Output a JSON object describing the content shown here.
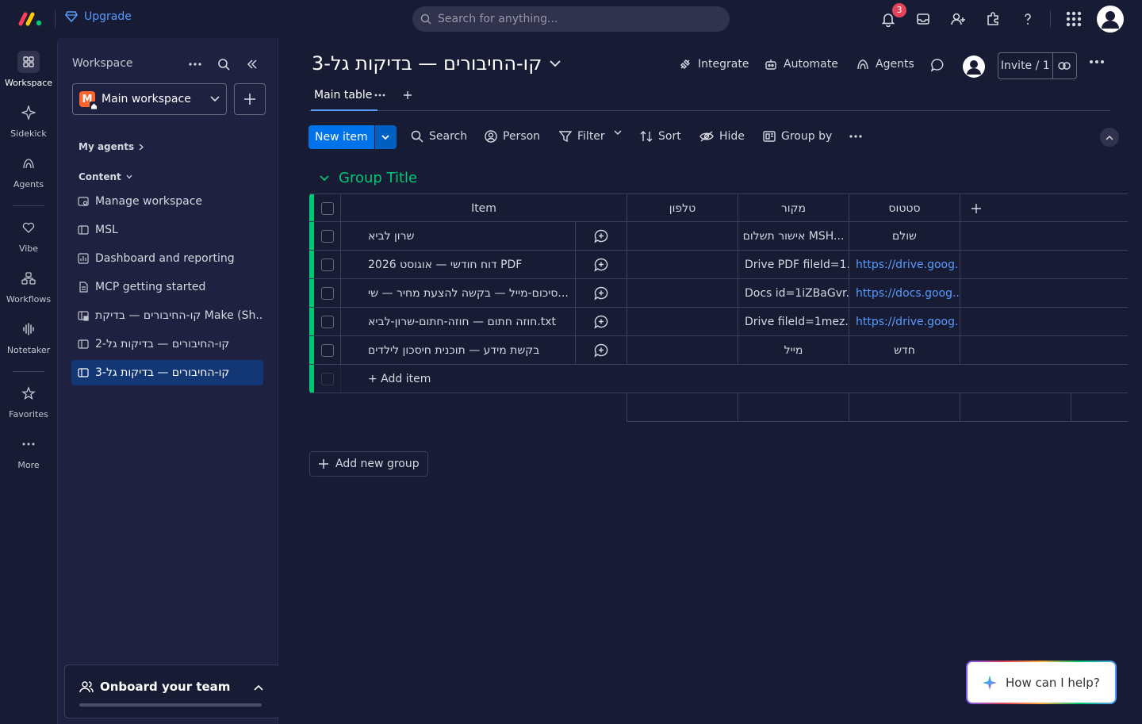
{
  "topbar": {
    "upgrade_label": "Upgrade",
    "search_placeholder": "Search for anything...",
    "notification_count": "3",
    "colors": {
      "accent": "#579bfc",
      "badge": "#e2445c"
    }
  },
  "rail": {
    "items": [
      {
        "label": "Workspace",
        "icon": "grid-icon"
      },
      {
        "label": "Sidekick",
        "icon": "sparkle-icon"
      },
      {
        "label": "Agents",
        "icon": "agents-icon"
      },
      {
        "label": "Vibe",
        "icon": "heart-icon"
      },
      {
        "label": "Workflows",
        "icon": "workflows-icon"
      },
      {
        "label": "Notetaker",
        "icon": "waveform-icon"
      },
      {
        "label": "Favorites",
        "icon": "star-icon"
      },
      {
        "label": "More",
        "icon": "more-icon"
      }
    ]
  },
  "workspace_panel": {
    "title": "Workspace",
    "selected_workspace": "Main workspace",
    "workspace_initial": "M",
    "my_agents_label": "My agents",
    "content_label": "Content",
    "items": [
      {
        "label": "Manage workspace"
      },
      {
        "label": "MSL"
      },
      {
        "label": "Dashboard and reporting"
      },
      {
        "label": "MCP getting started"
      },
      {
        "label": "קו-החיבורים — בדיקת Make (Sh..."
      },
      {
        "label": "קו-החיבורים — בדיקות גל-2"
      },
      {
        "label": "קו-החיבורים — בדיקות גל-3"
      }
    ],
    "onboard_label": "Onboard your team"
  },
  "board": {
    "title": "קו-החיבורים — בדיקות גל-3",
    "integrate_label": "Integrate",
    "automate_label": "Automate",
    "agents_label": "Agents",
    "invite_label": "Invite / 1",
    "tabs": [
      {
        "label": "Main table"
      }
    ],
    "toolbar": {
      "new_item": "New item",
      "search": "Search",
      "person": "Person",
      "filter": "Filter",
      "sort": "Sort",
      "hide": "Hide",
      "group_by": "Group by"
    },
    "group_title": "Group Title",
    "group_color": "#00c875",
    "columns": {
      "item": "Item",
      "phone": "טלפון",
      "source": "מקור",
      "status": "סטטוס"
    },
    "rows": [
      {
        "item": "שרון לביא",
        "phone": "",
        "source": "אישור תשלום MSH...",
        "status": "שולם",
        "status_is_link": false
      },
      {
        "item": "דוח חודשי — אוגוסט 2026 PDF",
        "phone": "",
        "source": "Drive PDF fileId=1...",
        "status": "https://drive.goog...",
        "status_is_link": true
      },
      {
        "item": "סיכום-מייל — בקשה להצעת מחיר — שי...",
        "phone": "",
        "source": "Docs id=1iZBaGvr...",
        "status": "https://docs.goog...",
        "status_is_link": true
      },
      {
        "item": "חוזה חתום — חוזה-חתום-שרון-לביא.txt",
        "phone": "",
        "source": "Drive fileId=1mez...",
        "status": "https://drive.goog...",
        "status_is_link": true
      },
      {
        "item": "בקשת מידע — תוכנית חיסכון לילדים",
        "phone": "",
        "source": "מייל",
        "status": "חדש",
        "status_is_link": false
      }
    ],
    "add_item_label": "+ Add item",
    "add_group_label": "Add new group"
  },
  "help_widget": {
    "label": "How can I help?"
  }
}
